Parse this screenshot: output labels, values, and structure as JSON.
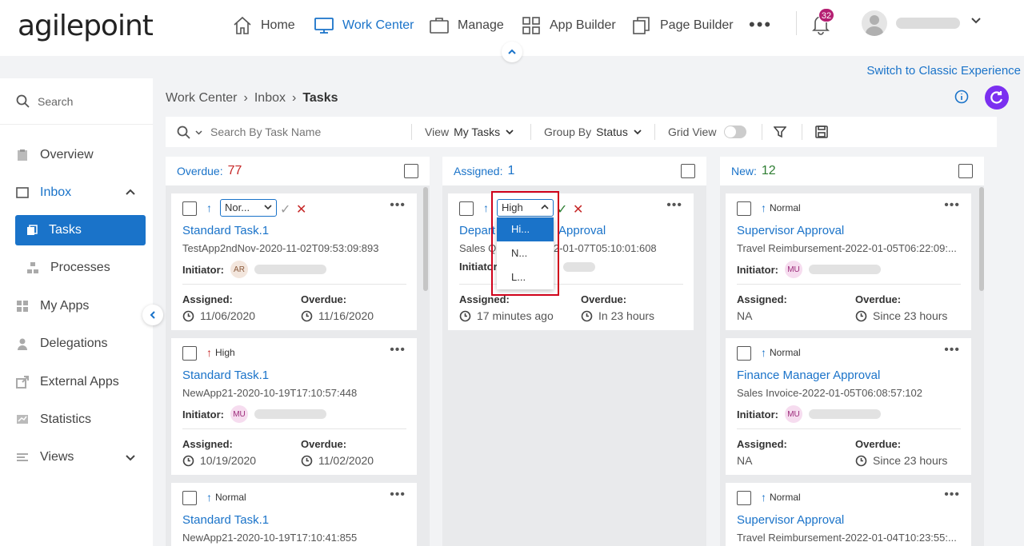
{
  "brand": {
    "logo_text": "agilepoint"
  },
  "nav": {
    "home": "Home",
    "work_center": "Work Center",
    "manage": "Manage",
    "app_builder": "App Builder",
    "page_builder": "Page Builder",
    "more": "•••",
    "notifications_count": "32"
  },
  "switch_link": "Switch to Classic Experience",
  "sidebar": {
    "search": "Search",
    "overview": "Overview",
    "inbox": "Inbox",
    "tasks": "Tasks",
    "processes": "Processes",
    "my_apps": "My Apps",
    "delegations": "Delegations",
    "external_apps": "External Apps",
    "statistics": "Statistics",
    "views": "Views"
  },
  "breadcrumb": {
    "a": "Work Center",
    "b": "Inbox",
    "c": "Tasks",
    "sep": "›"
  },
  "toolbar": {
    "search_placeholder": "Search By Task Name",
    "view_label": "View",
    "view_value": "My Tasks",
    "group_label": "Group By",
    "group_value": "Status",
    "grid_label": "Grid View"
  },
  "columns": {
    "overdue": {
      "label": "Overdue:",
      "count": "77"
    },
    "assigned": {
      "label": "Assigned:",
      "count": "1"
    },
    "new": {
      "label": "New:",
      "count": "12"
    }
  },
  "labels": {
    "initiator": "Initiator:",
    "assigned": "Assigned:",
    "overdue": "Overdue:",
    "more": "•••"
  },
  "cards": {
    "o1": {
      "priority_select": "Nor...",
      "title": "Standard Task.1",
      "sub": "TestApp2ndNov-2020-11-02T09:53:09:893",
      "initials": "AR",
      "assigned": "11/06/2020",
      "overdue": "11/16/2020"
    },
    "o2": {
      "priority": "High",
      "title": "Standard Task.1",
      "sub": "NewApp21-2020-10-19T17:10:57:448",
      "initials": "MU",
      "assigned": "10/19/2020",
      "overdue": "11/02/2020"
    },
    "o3": {
      "priority": "Normal",
      "title": "Standard Task.1",
      "sub": "NewApp21-2020-10-19T17:10:41:855"
    },
    "a1": {
      "priority_select": "High",
      "title_left": "Depart",
      "title_right": "Approval",
      "sub_left": "Sales Q",
      "sub_right": "2-01-07T05:10:01:608",
      "assigned": "17 minutes ago",
      "overdue": "In 23 hours"
    },
    "n1": {
      "priority": "Normal",
      "title": "Supervisor Approval",
      "sub": "Travel Reimbursement-2022-01-05T06:22:09:...",
      "initials": "MU",
      "assigned": "NA",
      "overdue": "Since 23 hours"
    },
    "n2": {
      "priority": "Normal",
      "title": "Finance Manager Approval",
      "sub": "Sales Invoice-2022-01-05T06:08:57:102",
      "initials": "MU",
      "assigned": "NA",
      "overdue": "Since 23 hours"
    },
    "n3": {
      "priority": "Normal",
      "title": "Supervisor Approval",
      "sub": "Travel Reimbursement-2022-01-04T10:23:55:..."
    }
  },
  "priority_dropdown": [
    "Hi...",
    "N...",
    "L..."
  ],
  "colors": {
    "accent": "#1a73c9",
    "badge": "#b51f72",
    "refresh": "#7b2ff0",
    "highlight": "#d0021b",
    "overdue_count": "#c62828",
    "new_count": "#2e7d32"
  }
}
